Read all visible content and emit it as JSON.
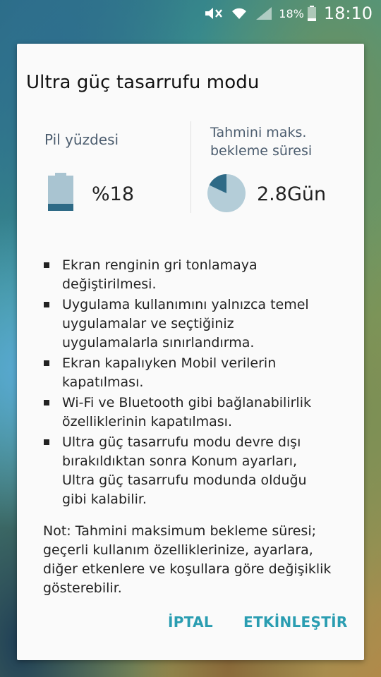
{
  "status_bar": {
    "icons": [
      "mute-icon",
      "wifi-icon",
      "signal-icon"
    ],
    "battery_percent": "18%",
    "time": "18:10"
  },
  "dialog": {
    "title": "Ultra güç tasarrufu modu",
    "battery": {
      "label": "Pil yüzdesi",
      "value": "%18",
      "level": 0.18
    },
    "standby": {
      "label_line1": "Tahmini maks.",
      "label_line2": "bekleme süresi",
      "value": "2.8Gün"
    },
    "features": [
      [
        "Ekran renginin gri tonlamaya",
        "değiştirilmesi."
      ],
      [
        "Uygulama kullanımını yalnızca temel",
        "uygulamalar ve seçtiğiniz",
        "uygulamalarla sınırlandırma."
      ],
      [
        "Ekran kapalıyken Mobil verilerin",
        "kapatılması."
      ],
      [
        "Wi-Fi ve Bluetooth gibi bağlanabilirlik",
        "özelliklerinin kapatılması."
      ],
      [
        "Ultra güç tasarrufu modu devre dışı",
        "bırakıldıktan sonra Konum ayarları,",
        "Ultra güç tasarrufu modunda olduğu",
        "gibi kalabilir."
      ]
    ],
    "note": [
      "Not: Tahmini maksimum bekleme süresi;",
      "geçerli kullanım özelliklerinize, ayarlara,",
      "diğer etkenlere ve koşullara göre değişiklik",
      "gösterebilir."
    ],
    "cancel_label": "İPTAL",
    "enable_label": "ETKİNLEŞTİR"
  },
  "colors": {
    "accent": "#2a9db1",
    "battery_fill": "#2e6a86",
    "battery_empty": "#a9c4d1",
    "pie_empty": "#b4cdd8",
    "pie_fill": "#2e6a86"
  }
}
